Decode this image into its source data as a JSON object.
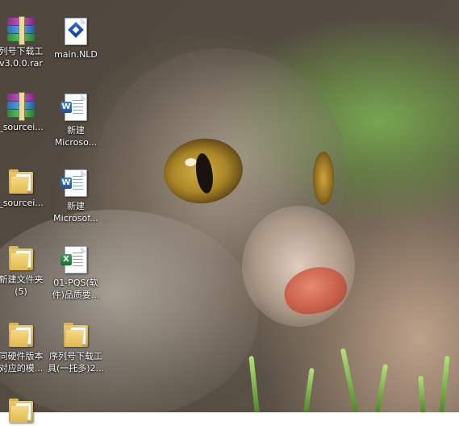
{
  "desktop": {
    "icons": [
      {
        "label": "列号下载工",
        "label2": "v3.0.0.rar",
        "icon": "archive-icon"
      },
      {
        "label": "main.NLD",
        "label2": "",
        "icon": "nld-file-icon"
      },
      {
        "label": "_sourcei...",
        "label2": "",
        "icon": "archive-icon"
      },
      {
        "label": "新建",
        "label2": "Microso...",
        "icon": "word-document-icon"
      },
      {
        "label": "_sourcei...",
        "label2": "",
        "icon": "folder-icon"
      },
      {
        "label": "新建",
        "label2": "Microsof...",
        "icon": "word-document-icon"
      },
      {
        "label": "新建文件夹",
        "label2": "(5)",
        "icon": "folder-icon"
      },
      {
        "label": "01-PQS(软",
        "label2": "件)品质要...",
        "icon": "excel-document-icon"
      },
      {
        "label": "同硬件版本",
        "label2": "对应的模...",
        "icon": "folder-icon"
      },
      {
        "label": "序列号下载工",
        "label2": "具(一托多)2...",
        "icon": "folder-icon"
      },
      {
        "label": "",
        "label2": "",
        "icon": "folder-icon"
      }
    ]
  }
}
